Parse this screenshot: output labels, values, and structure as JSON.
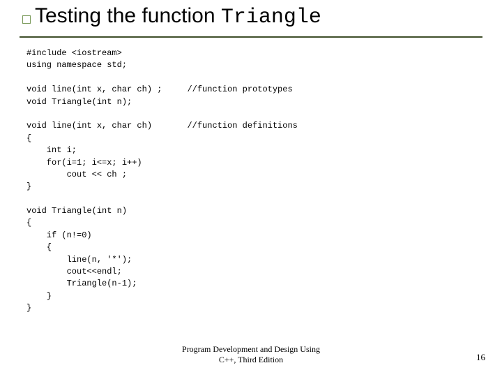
{
  "title": {
    "pre": "Testing the function ",
    "mono": "Triangle"
  },
  "code": "#include <iostream>\nusing namespace std;\n\nvoid line(int x, char ch) ;     //function prototypes\nvoid Triangle(int n);\n\nvoid line(int x, char ch)       //function definitions\n{\n    int i;\n    for(i=1; i<=x; i++)\n        cout << ch ;\n}\n\nvoid Triangle(int n)\n{\n    if (n!=0)\n    {\n        line(n, '*');\n        cout<<endl;\n        Triangle(n-1);\n    }\n}",
  "footer": {
    "line1": "Program Development and Design Using",
    "line2": "C++, Third Edition"
  },
  "page_number": "16"
}
